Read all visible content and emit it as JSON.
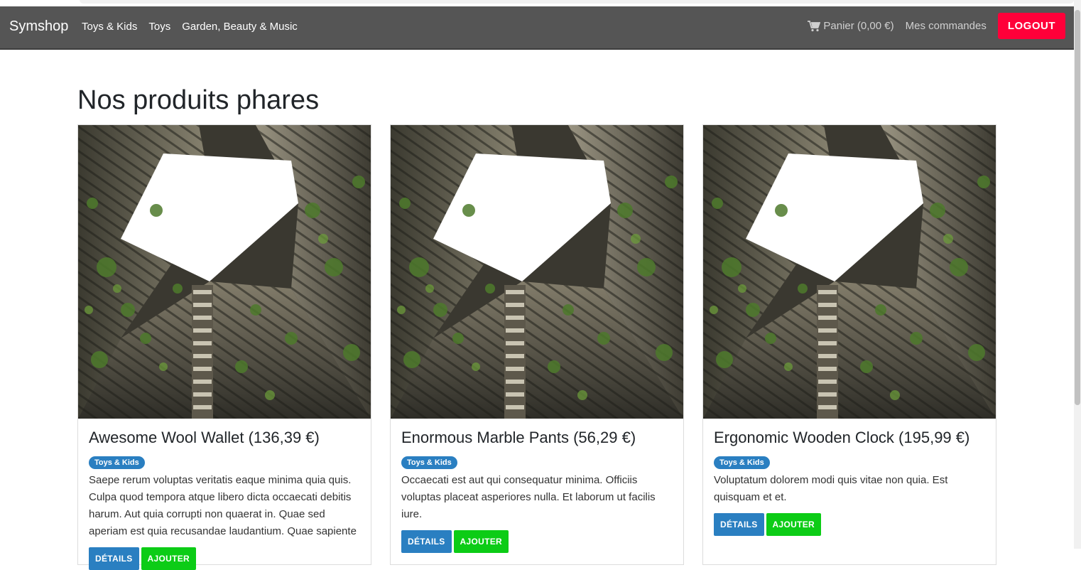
{
  "navbar": {
    "brand": "Symshop",
    "categories": [
      "Toys & Kids",
      "Toys",
      "Garden, Beauty & Music"
    ],
    "cart_label": "Panier (0,00 €)",
    "orders_label": "Mes commandes",
    "logout_label": "LOGOUT"
  },
  "main": {
    "heading": "Nos produits phares",
    "products": [
      {
        "title": "Awesome Wool Wallet (136,39 €)",
        "category": "Toys & Kids",
        "description": "Saepe rerum voluptas veritatis eaque minima quia quis. Culpa quod tempora atque libero dicta occaecati debitis harum. Aut quia corrupti non quaerat in. Quae sed aperiam est quia recusandae laudantium. Quae sapiente",
        "details_label": "DÉTAILS",
        "add_label": "AJOUTER"
      },
      {
        "title": "Enormous Marble Pants (56,29 €)",
        "category": "Toys & Kids",
        "description": "Occaecati est aut qui consequatur minima. Officiis voluptas placeat asperiores nulla. Et laborum ut facilis iure.",
        "details_label": "DÉTAILS",
        "add_label": "AJOUTER"
      },
      {
        "title": "Ergonomic Wooden Clock (195,99 €)",
        "category": "Toys & Kids",
        "description": "Voluptatum dolorem modi quis vitae non quia. Est quisquam et et.",
        "details_label": "DÉTAILS",
        "add_label": "AJOUTER"
      }
    ]
  },
  "colors": {
    "navbar_bg": "#555555",
    "logout_bg": "#ff0039",
    "badge_bg": "#2a7fc1",
    "details_bg": "#2a7fc1",
    "add_bg": "#0ccc16"
  }
}
